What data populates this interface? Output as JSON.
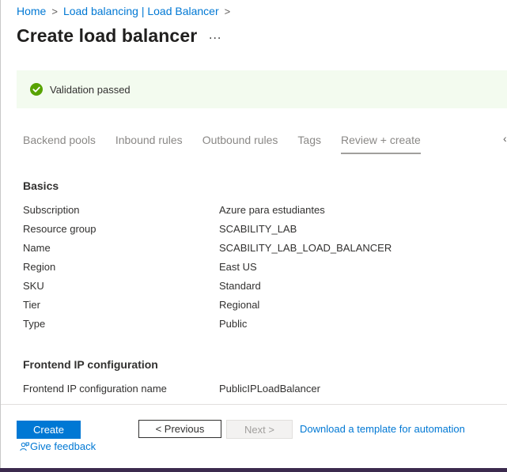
{
  "breadcrumb": {
    "items": [
      "Home",
      "Load balancing | Load Balancer"
    ],
    "separator": ">"
  },
  "header": {
    "title": "Create load balancer",
    "more_label": "..."
  },
  "banner": {
    "text": "Validation passed",
    "status_color": "#57a300"
  },
  "tabs": [
    {
      "label": "Backend pools"
    },
    {
      "label": "Inbound rules"
    },
    {
      "label": "Outbound rules"
    },
    {
      "label": "Tags"
    },
    {
      "label": "Review + create",
      "active": true
    }
  ],
  "sections": {
    "basics": {
      "title": "Basics",
      "rows": [
        {
          "key": "Subscription",
          "value": "Azure para estudiantes"
        },
        {
          "key": "Resource group",
          "value": "SCABILITY_LAB"
        },
        {
          "key": "Name",
          "value": "SCABILITY_LAB_LOAD_BALANCER"
        },
        {
          "key": "Region",
          "value": "East US"
        },
        {
          "key": "SKU",
          "value": "Standard"
        },
        {
          "key": "Tier",
          "value": "Regional"
        },
        {
          "key": "Type",
          "value": "Public"
        }
      ]
    },
    "frontend": {
      "title": "Frontend IP configuration",
      "rows": [
        {
          "key": "Frontend IP configuration name",
          "value": "PublicIPLoadBalancer"
        }
      ]
    }
  },
  "footer": {
    "create_label": "Create",
    "previous_label": "< Previous",
    "next_label": "Next >",
    "download_label": "Download a template for automation",
    "feedback_label": "Give feedback"
  },
  "colors": {
    "accent": "#0078d4",
    "banner_bg": "#f3fbef"
  }
}
